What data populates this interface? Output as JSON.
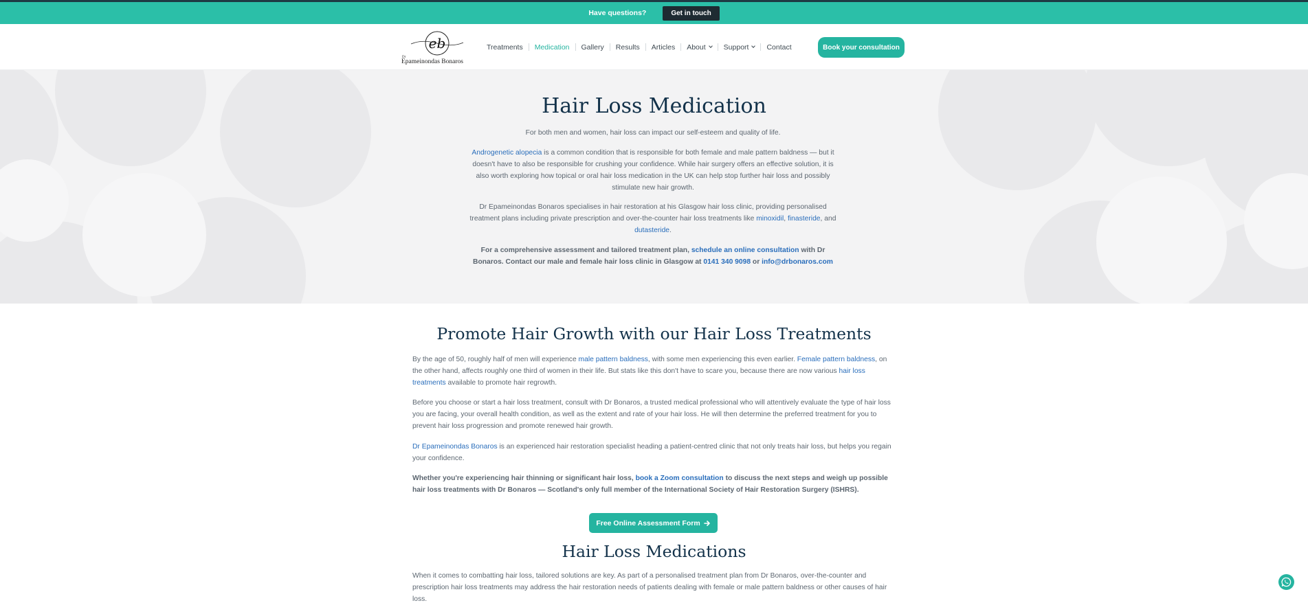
{
  "topbar": {
    "question": "Have questions?",
    "cta": "Get in touch"
  },
  "logo": {
    "monogram": "eb",
    "dr": "Dr",
    "name": "Epameinondas Bonaros"
  },
  "nav": {
    "items": [
      "Treatments",
      "Medication",
      "Gallery",
      "Results",
      "Articles",
      "About",
      "Support",
      "Contact"
    ],
    "active": "Medication",
    "book_cta": "Book your consultation"
  },
  "hero": {
    "title": "Hair Loss Medication",
    "subtitle": "For both men and women, hair loss can impact our self-esteem and quality of life.",
    "p1_link": "Androgenetic alopecia",
    "p1_text": " is a common condition that is responsible for both female and male pattern baldness — but it doesn't have to also be responsible for crushing your confidence. While hair surgery offers an effective solution, it is also worth exploring how topical or oral hair loss medication in the UK can help stop further hair loss and possibly stimulate new hair growth.",
    "p2_text": "Dr Epameinondas Bonaros specialises in hair restoration at his Glasgow hair loss clinic, providing personalised treatment plans including private prescription and over-the-counter hair loss treatments like ",
    "p2_link1": "minoxidil",
    "p2_sep1": ", ",
    "p2_link2": "finasteride",
    "p2_sep2": ", and ",
    "p2_link3": "dutasteride",
    "p2_end": ".",
    "p3_text1": "For a comprehensive assessment and tailored treatment plan, ",
    "p3_link1": "schedule an online consultation",
    "p3_text2": " with Dr Bonaros. Contact our male and female hair loss clinic in Glasgow at ",
    "p3_phone": "0141 340 9098",
    "p3_or": " or ",
    "p3_email": "info@drbonaros.com"
  },
  "promote": {
    "title": "Promote Hair Growth with our Hair Loss Treatments",
    "p1_a": "By the age of 50, roughly half of men will experience ",
    "p1_link1": "male pattern baldness",
    "p1_b": ", with some men experiencing this even earlier. ",
    "p1_link2": "Female pattern baldness",
    "p1_c": ", on the other hand, affects roughly one third of women in their life. But stats like this don't have to scare you, because there are now various ",
    "p1_link3": "hair loss treatments",
    "p1_d": " available to promote hair regrowth.",
    "p2": "Before you choose or start a hair loss treatment, consult with Dr Bonaros, a trusted medical professional who will attentively evaluate the type of hair loss you are facing, your overall health condition, as well as the extent and rate of your hair loss. He will then determine the preferred treatment for you to prevent hair loss progression and promote renewed hair growth.",
    "p3_link": "Dr Epameinondas Bonaros",
    "p3_text": " is an experienced hair restoration specialist heading a patient-centred clinic that not only treats hair loss, but helps you regain your confidence.",
    "p4_a": "Whether you're experiencing hair thinning or significant hair loss, ",
    "p4_link": "book a Zoom consultation",
    "p4_b": " to discuss the next steps and weigh up possible hair loss treatments with Dr Bonaros — Scotland's only full member of the International Society of Hair Restoration Surgery (ISHRS).",
    "cta": "Free Online Assessment Form"
  },
  "medications": {
    "title": "Hair Loss Medications",
    "p1": "When it comes to combatting hair loss, tailored solutions are key. As part of a personalised treatment plan from Dr Bonaros, over-the-counter and prescription hair loss treatments may address the hair restoration needs of patients dealing with female or male pattern baldness or other causes of hair loss."
  },
  "icons": {
    "arrow": "arrow-right-icon",
    "whatsapp": "whatsapp-icon",
    "chevron": "chevron-down-icon"
  },
  "colors": {
    "accent": "#25b4a0",
    "topbar": "#2bbfa8",
    "heading": "#13324a",
    "link": "#2a6ebb"
  }
}
